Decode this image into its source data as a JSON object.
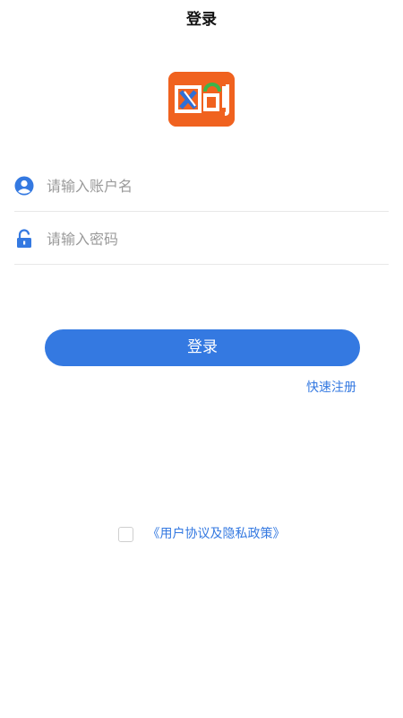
{
  "header": {
    "title": "登录"
  },
  "logo": {
    "text": "网创",
    "background_color": "#f0621f"
  },
  "form": {
    "username": {
      "icon": "user-icon",
      "placeholder": "请输入账户名",
      "value": ""
    },
    "password": {
      "icon": "lock-icon",
      "placeholder": "请输入密码",
      "value": ""
    }
  },
  "actions": {
    "login_label": "登录",
    "register_label": "快速注册"
  },
  "agreement": {
    "checked": false,
    "link_label": "《用户协议及隐私政策》"
  },
  "colors": {
    "accent": "#3479e1",
    "divider": "#e8e8e8",
    "placeholder": "#9a9a9a"
  }
}
